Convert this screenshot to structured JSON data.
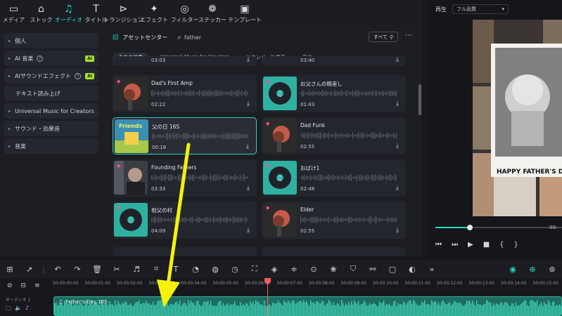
{
  "toolbar": {
    "items": [
      {
        "label": "メディア",
        "icon": "media-icon",
        "glyph": "▭"
      },
      {
        "label": "ストック",
        "icon": "stock-icon",
        "glyph": "⌂"
      },
      {
        "label": "オーディオ",
        "icon": "audio-icon",
        "glyph": "♫",
        "active": true
      },
      {
        "label": "タイトル",
        "icon": "title-icon",
        "glyph": "T"
      },
      {
        "label": "トランジション",
        "icon": "transition-icon",
        "glyph": "⊳"
      },
      {
        "label": "エフェクト",
        "icon": "effect-icon",
        "glyph": "✦"
      },
      {
        "label": "フィルター",
        "icon": "filter-icon",
        "glyph": "◎"
      },
      {
        "label": "ステッカー",
        "icon": "sticker-icon",
        "glyph": "❁"
      },
      {
        "label": "テンプレート",
        "icon": "template-icon",
        "glyph": "▣"
      }
    ]
  },
  "sidebar": {
    "items": [
      {
        "label": "個人",
        "caret": true
      },
      {
        "label": "AI 音楽",
        "caret": true,
        "help": true,
        "ai": "AI"
      },
      {
        "label": "AIサウンドエフェクト",
        "caret": true,
        "help": true,
        "ai": "AI"
      },
      {
        "label": "テキスト読み上げ",
        "caret": false
      },
      {
        "label": "Universal Music for Creators",
        "caret": true
      },
      {
        "label": "サウンド・効果音",
        "caret": true
      },
      {
        "label": "音楽",
        "caret": true
      }
    ]
  },
  "content": {
    "asset_center": "アセットセンター",
    "search_value": "father",
    "filter_label": "すべて",
    "tabs": [
      "全ての結果",
      "Universal Music for Creators",
      "サウンド・効果音",
      "音楽"
    ],
    "top_durations": [
      "03:03",
      "03:40"
    ],
    "cards": [
      {
        "title": "Dad's First Amp",
        "duration": "02:22",
        "thumb": "rose"
      },
      {
        "title": "お父さんの眼差し",
        "duration": "01:43",
        "thumb": "teal"
      },
      {
        "title": "父の日 16S",
        "duration": "00:16",
        "thumb": "friends",
        "selected": true
      },
      {
        "title": "Dad Funk",
        "duration": "02:55",
        "thumb": "rose"
      },
      {
        "title": "Founding Fathers",
        "duration": "03:33",
        "thumb": "man"
      },
      {
        "title": "おばけ1",
        "duration": "02:48",
        "thumb": "teal"
      },
      {
        "title": "祖父の村",
        "duration": "04:09",
        "thumb": "teal"
      },
      {
        "title": "Elder",
        "duration": "02:55",
        "thumb": "rose"
      }
    ]
  },
  "preview": {
    "label": "再生",
    "quality": "フル品質",
    "banner": "HAPPY FATHER'S D",
    "time_right": "00:"
  },
  "timeline": {
    "track_name": "オーディオ 1",
    "clip_label": "Father's Day 16S",
    "ticks": [
      "00:00:00:00",
      "00:00:01:00",
      "00:00:02:00",
      "00:00:03:00",
      "00:00:04:00",
      "00:00:05:00",
      "00:00:06:00",
      "00:00:07:00",
      "00:00:08:00",
      "00:00:09:00",
      "00:00:10:00",
      "00:00:11:00",
      "00:00:12:00",
      "00:00:13:00",
      "00:00:14:00",
      "00:00:15:00"
    ]
  },
  "colors": {
    "accent": "#27d6c0",
    "arrow": "#f5f10a",
    "playhead": "#ff5a5a"
  }
}
